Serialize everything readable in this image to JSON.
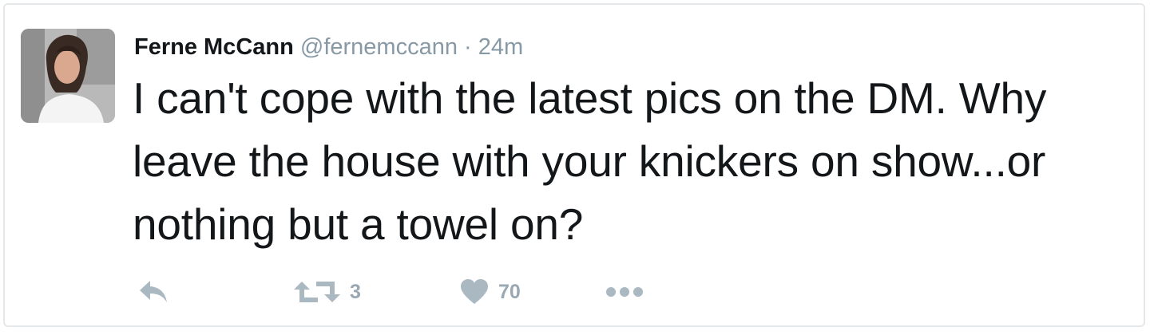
{
  "tweet": {
    "display_name": "Ferne McCann",
    "handle": "@fernemccann",
    "separator": "·",
    "timestamp": "24m",
    "text": "I can't cope with the latest pics on the DM. Why leave the house with your knickers on show...or nothing but a towel on?",
    "avatar_icon": "profile-photo",
    "actions": {
      "reply_icon": "reply-icon",
      "retweet_icon": "retweet-icon",
      "retweet_count": "3",
      "like_icon": "heart-icon",
      "like_count": "70",
      "more_icon": "more-dots-icon"
    }
  },
  "colors": {
    "text": "#14171a",
    "secondary": "#8899a6",
    "action_icon": "#aab8c2",
    "border": "#e4e8ea"
  }
}
